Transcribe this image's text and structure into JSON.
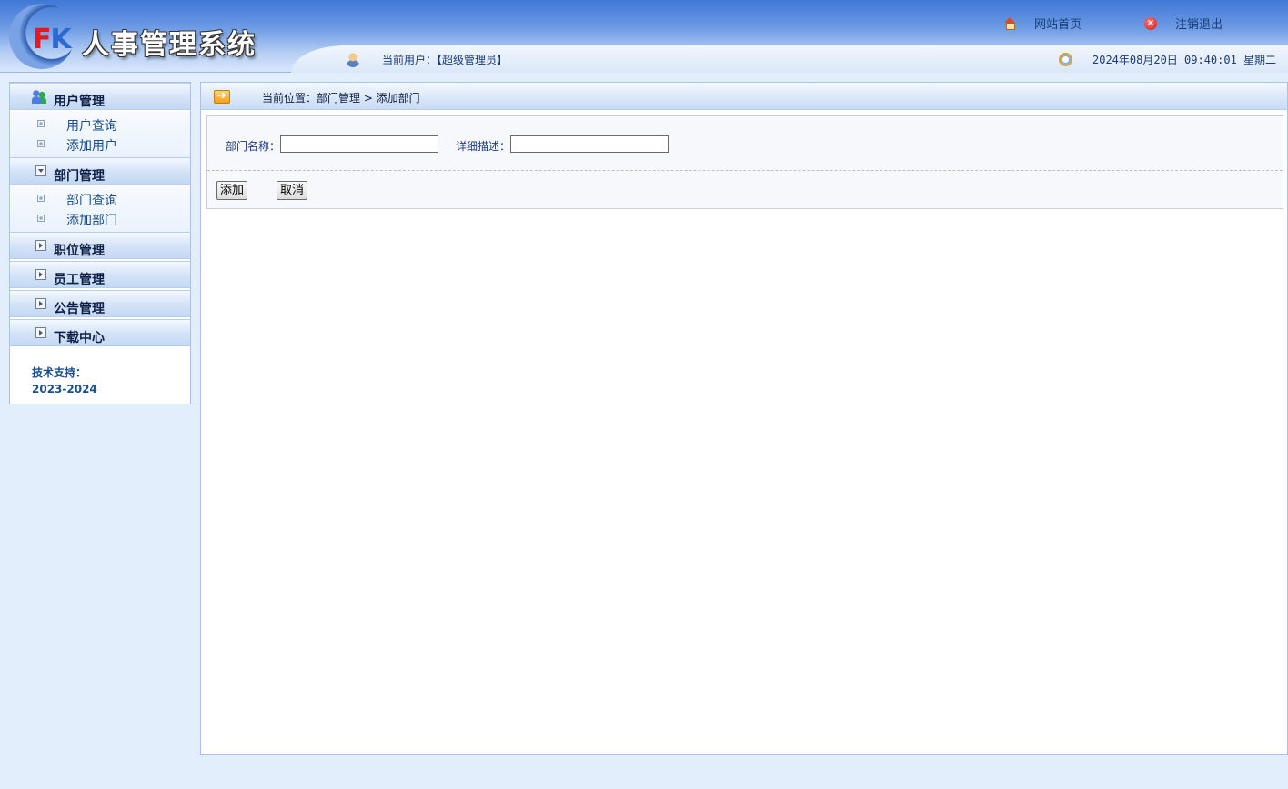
{
  "header": {
    "logo_mark_f": "F",
    "logo_mark_k": "K",
    "title": "人事管理系统",
    "home_link": "网站首页",
    "logout_link": "注销退出",
    "current_user": "当前用户：【超级管理员】",
    "datetime": "2024年08月20日 09:40:01 星期二"
  },
  "sidebar": {
    "groups": [
      {
        "label": "用户管理",
        "items": [
          "用户查询",
          "添加用户"
        ]
      },
      {
        "label": "部门管理",
        "items": [
          "部门查询",
          "添加部门"
        ]
      },
      {
        "label": "职位管理"
      },
      {
        "label": "员工管理"
      },
      {
        "label": "公告管理"
      },
      {
        "label": "下载中心"
      }
    ],
    "support_label": "技术支持：",
    "support_years": "2023-2024"
  },
  "main": {
    "breadcrumb": "当前位置：部门管理 > 添加部门",
    "form": {
      "name_label": "部门名称：",
      "name_value": "",
      "desc_label": "详细描述：",
      "desc_value": "",
      "add_button": "添加",
      "cancel_button": "取消"
    }
  },
  "colors": {
    "header_blue": "#3f78d6",
    "text_blue": "#1a3c7a",
    "page_bg": "#e3eefc"
  }
}
